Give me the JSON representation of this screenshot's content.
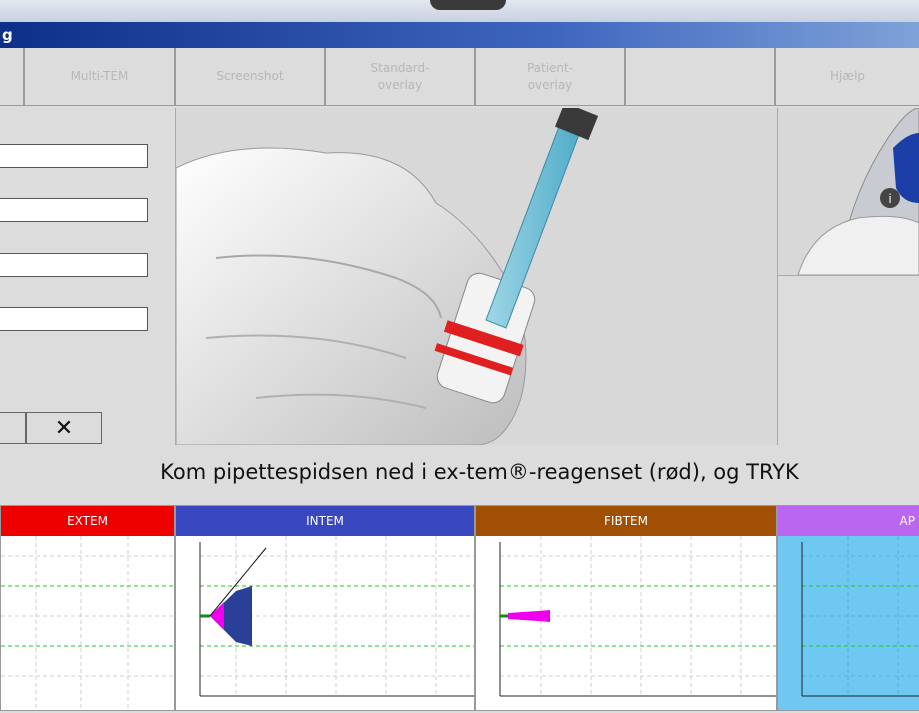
{
  "window": {
    "title": "g"
  },
  "toolbar": {
    "buttons": [
      {
        "label": ""
      },
      {
        "label": "Multi-TEM"
      },
      {
        "label": "Screenshot"
      },
      {
        "label": "Standard-\noverlay"
      },
      {
        "label": "Patient-\noverlay"
      },
      {
        "label": ""
      },
      {
        "label": "Hjælp"
      }
    ]
  },
  "form": {
    "cancel_label": "✕"
  },
  "instruction": "Kom pipettespidsen ned i ex-tem®-reagenset (rød), og TRYK",
  "channels": [
    {
      "name": "EXTEM",
      "color": "#ee0000"
    },
    {
      "name": "INTEM",
      "color": "#3a48c0"
    },
    {
      "name": "FIBTEM",
      "color": "#a24f06"
    },
    {
      "name": "AP",
      "color": "#bb66f0"
    }
  ],
  "colors": {
    "gridline": "#22cc22",
    "trace_main": "#ee00ee",
    "trace_fill": "#2a3f98",
    "aptem_bg": "#6ec8f2"
  }
}
